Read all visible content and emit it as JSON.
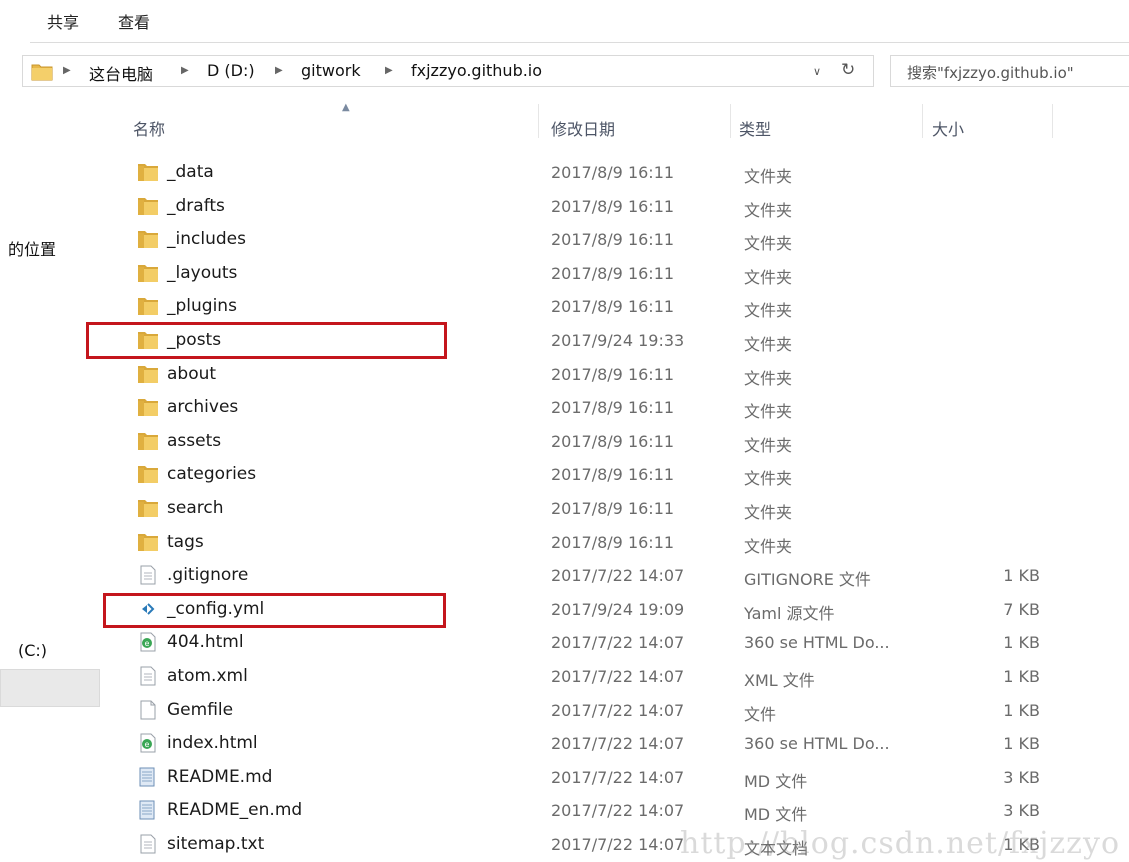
{
  "ribbon": {
    "tabs": [
      "共享",
      "查看"
    ]
  },
  "address": {
    "crumbs": [
      "这台电脑",
      "D (D:)",
      "gitwork",
      "fxjzzyo.github.io"
    ],
    "dropdown_icon": "chevron-down-icon",
    "refresh_icon": "refresh-icon"
  },
  "search": {
    "placeholder": "搜索\"fxjzzyo.github.io\""
  },
  "columns": {
    "name": "名称",
    "date": "修改日期",
    "type": "类型",
    "size": "大小"
  },
  "nav": {
    "location_label": "的位置",
    "drive_label": "(C:)"
  },
  "colors": {
    "highlight": "#c4161c",
    "folder": "#e8b84a"
  },
  "files": [
    {
      "name": "_data",
      "date": "2017/8/9 16:11",
      "type": "文件夹",
      "size": "",
      "icon": "folder-icon"
    },
    {
      "name": "_drafts",
      "date": "2017/8/9 16:11",
      "type": "文件夹",
      "size": "",
      "icon": "folder-icon"
    },
    {
      "name": "_includes",
      "date": "2017/8/9 16:11",
      "type": "文件夹",
      "size": "",
      "icon": "folder-icon"
    },
    {
      "name": "_layouts",
      "date": "2017/8/9 16:11",
      "type": "文件夹",
      "size": "",
      "icon": "folder-icon"
    },
    {
      "name": "_plugins",
      "date": "2017/8/9 16:11",
      "type": "文件夹",
      "size": "",
      "icon": "folder-icon"
    },
    {
      "name": "_posts",
      "date": "2017/9/24 19:33",
      "type": "文件夹",
      "size": "",
      "icon": "folder-icon"
    },
    {
      "name": "about",
      "date": "2017/8/9 16:11",
      "type": "文件夹",
      "size": "",
      "icon": "folder-icon"
    },
    {
      "name": "archives",
      "date": "2017/8/9 16:11",
      "type": "文件夹",
      "size": "",
      "icon": "folder-icon"
    },
    {
      "name": "assets",
      "date": "2017/8/9 16:11",
      "type": "文件夹",
      "size": "",
      "icon": "folder-icon"
    },
    {
      "name": "categories",
      "date": "2017/8/9 16:11",
      "type": "文件夹",
      "size": "",
      "icon": "folder-icon"
    },
    {
      "name": "search",
      "date": "2017/8/9 16:11",
      "type": "文件夹",
      "size": "",
      "icon": "folder-icon"
    },
    {
      "name": "tags",
      "date": "2017/8/9 16:11",
      "type": "文件夹",
      "size": "",
      "icon": "folder-icon"
    },
    {
      "name": ".gitignore",
      "date": "2017/7/22 14:07",
      "type": "GITIGNORE 文件",
      "size": "1 KB",
      "icon": "text-file-icon"
    },
    {
      "name": "_config.yml",
      "date": "2017/9/24 19:09",
      "type": "Yaml 源文件",
      "size": "7 KB",
      "icon": "vscode-file-icon"
    },
    {
      "name": "404.html",
      "date": "2017/7/22 14:07",
      "type": "360 se HTML Do...",
      "size": "1 KB",
      "icon": "browser-file-icon"
    },
    {
      "name": "atom.xml",
      "date": "2017/7/22 14:07",
      "type": "XML 文件",
      "size": "1 KB",
      "icon": "text-file-icon"
    },
    {
      "name": "Gemfile",
      "date": "2017/7/22 14:07",
      "type": "文件",
      "size": "1 KB",
      "icon": "blank-file-icon"
    },
    {
      "name": "index.html",
      "date": "2017/7/22 14:07",
      "type": "360 se HTML Do...",
      "size": "1 KB",
      "icon": "browser-file-icon"
    },
    {
      "name": "README.md",
      "date": "2017/7/22 14:07",
      "type": "MD 文件",
      "size": "3 KB",
      "icon": "markdown-file-icon"
    },
    {
      "name": "README_en.md",
      "date": "2017/7/22 14:07",
      "type": "MD 文件",
      "size": "3 KB",
      "icon": "markdown-file-icon"
    },
    {
      "name": "sitemap.txt",
      "date": "2017/7/22 14:07",
      "type": "文本文档",
      "size": "1 KB",
      "icon": "text-file-icon"
    }
  ],
  "watermark": "http://blog.csdn.net/fxjzzyo"
}
